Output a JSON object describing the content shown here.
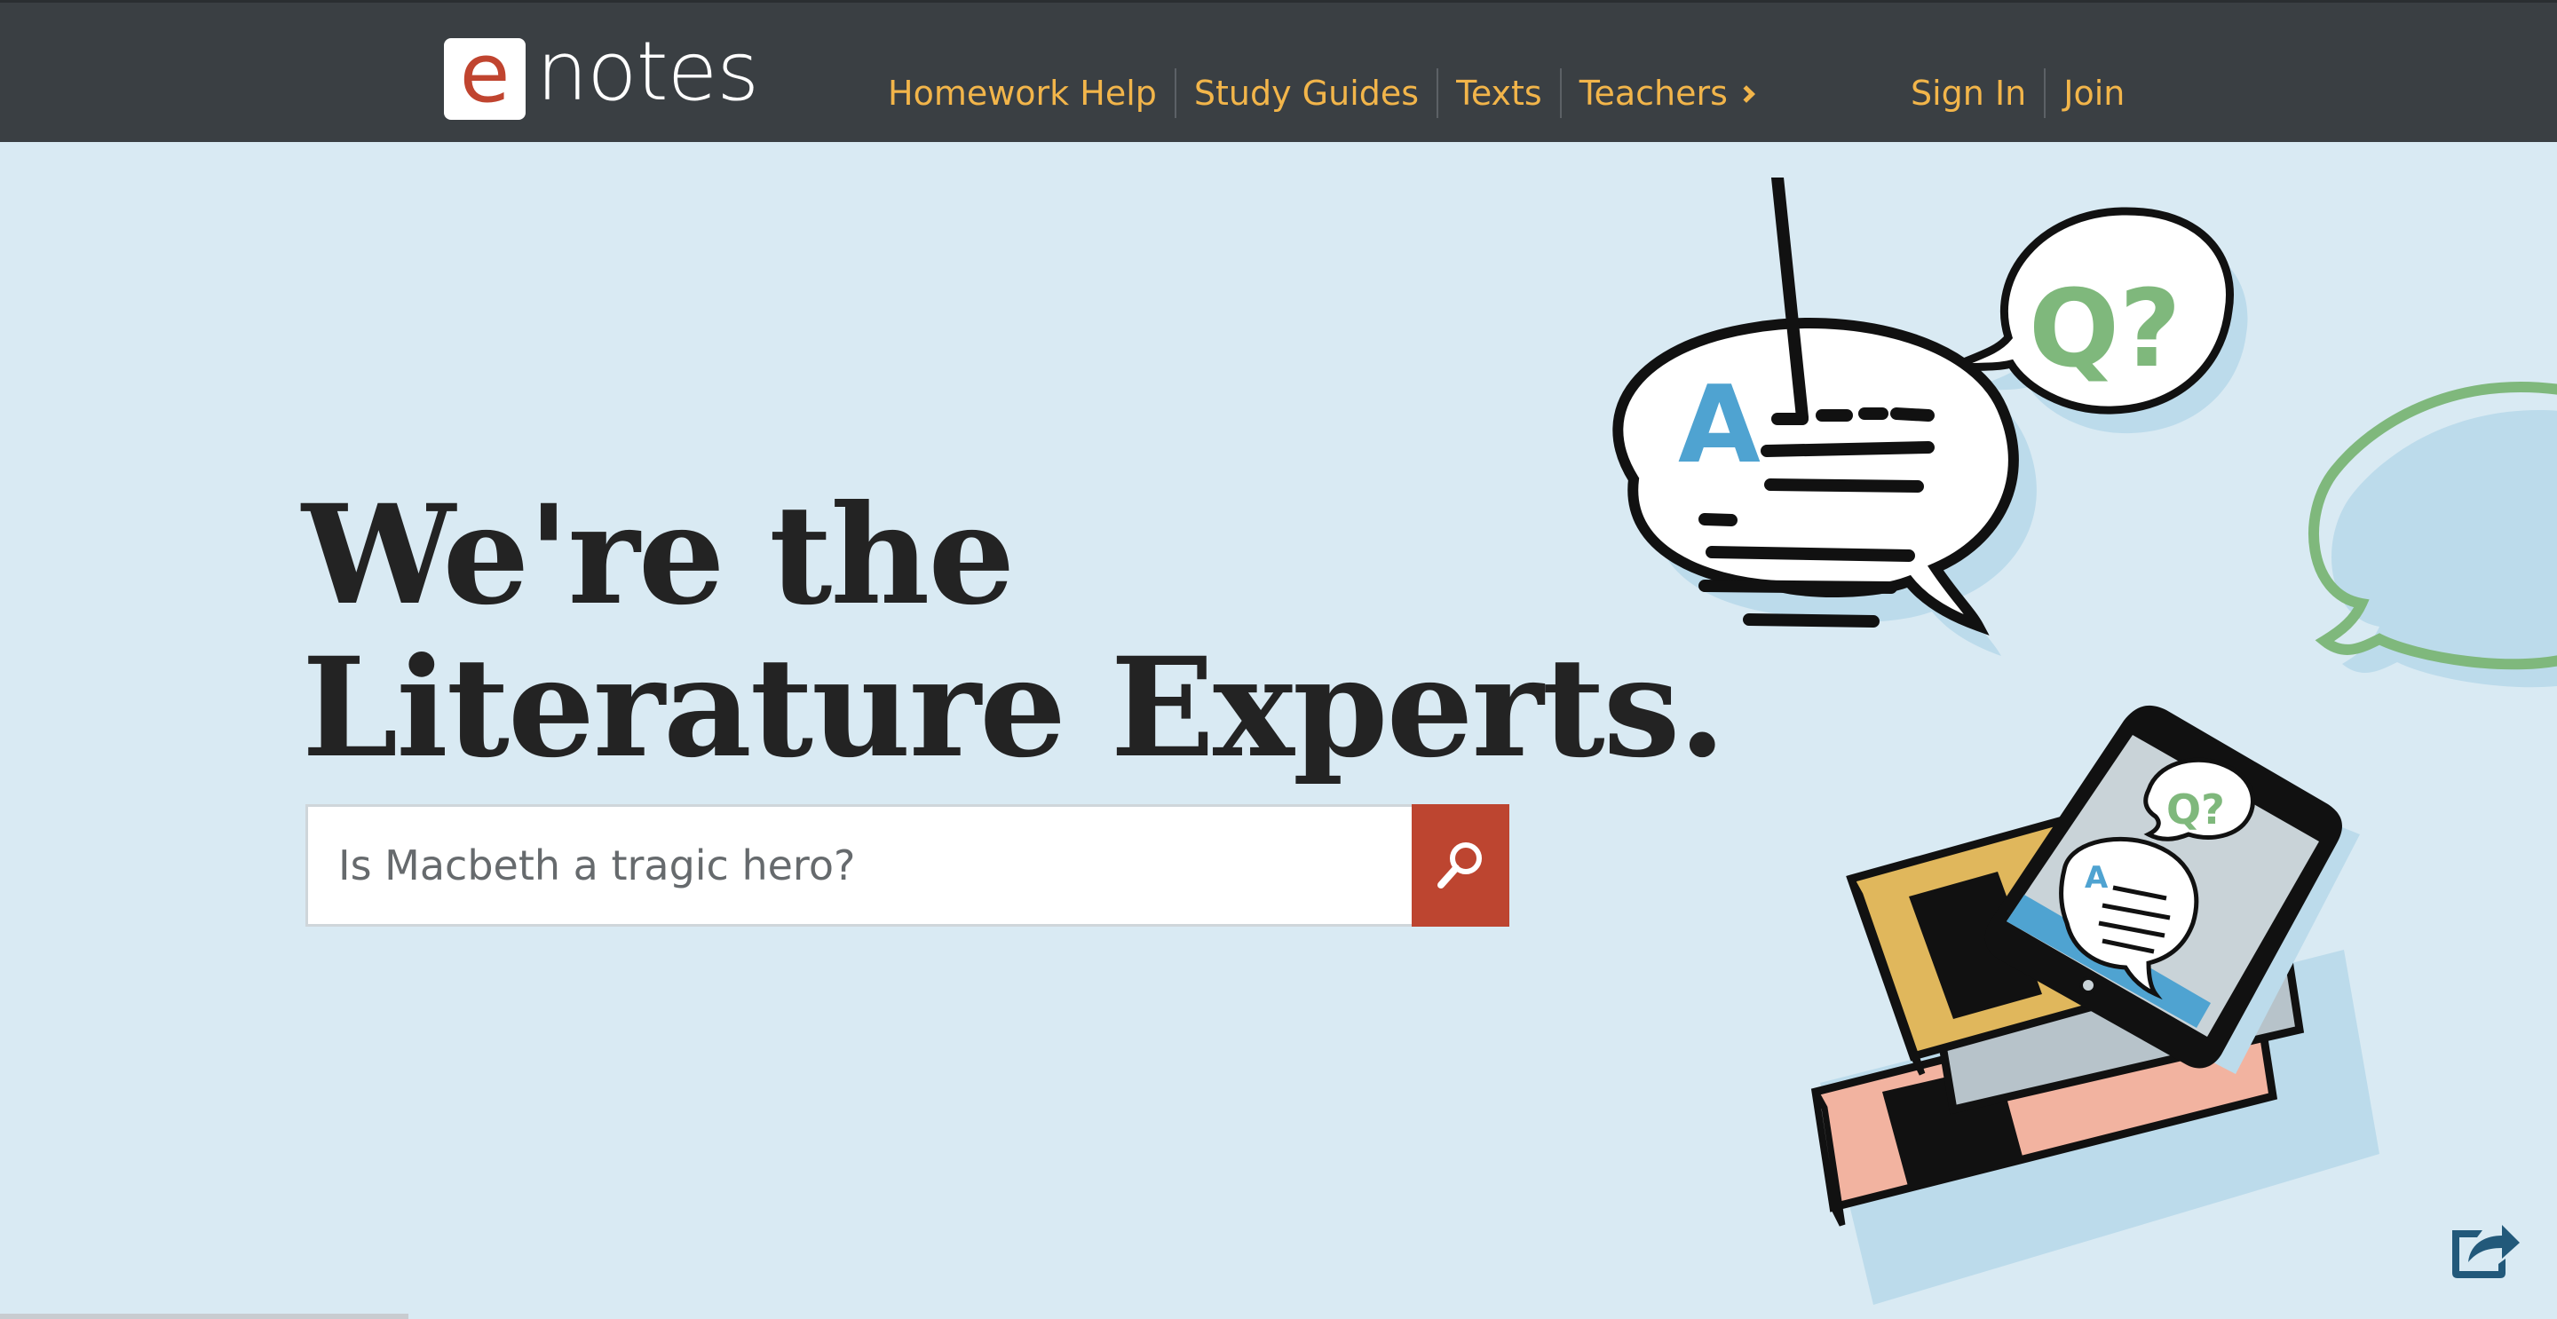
{
  "brand": {
    "logo_letter": "e",
    "logo_word": "notes",
    "accent": "#c0442f"
  },
  "nav": {
    "items": [
      {
        "label": "Homework Help"
      },
      {
        "label": "Study Guides"
      },
      {
        "label": "Texts"
      },
      {
        "label": "Teachers",
        "icon": "chevron-right-icon"
      }
    ],
    "color": "#f2b54a"
  },
  "auth": {
    "sign_in": "Sign In",
    "join": "Join"
  },
  "hero": {
    "line1": "We're the",
    "line2": "Literature Experts."
  },
  "search": {
    "placeholder": "Is Macbeth a tragic hero?",
    "button_icon": "search-icon",
    "button_color": "#bd4530"
  },
  "illustration": {
    "bubble_q_text": "Q?",
    "bubble_a_text": "A",
    "tablet_bubble_q_text": "Q?",
    "tablet_bubble_a_text": "A"
  },
  "share": {
    "icon": "share-icon"
  }
}
